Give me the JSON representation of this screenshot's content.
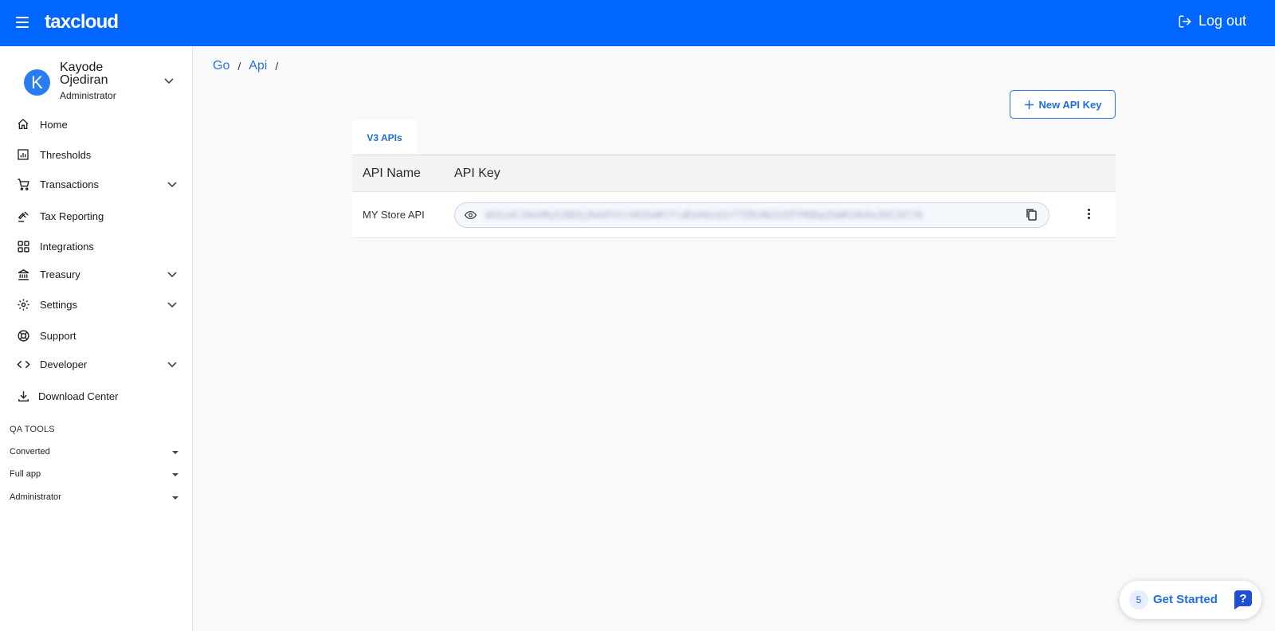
{
  "app": {
    "brand": "taxcloud",
    "logout_label": "Log out"
  },
  "user": {
    "initial": "K",
    "name": "Kayode Ojediran",
    "role": "Administrator"
  },
  "sidebar": {
    "items": [
      {
        "label": "Home"
      },
      {
        "label": "Thresholds"
      },
      {
        "label": "Transactions"
      },
      {
        "label": "Tax Reporting"
      },
      {
        "label": "Integrations"
      },
      {
        "label": "Treasury"
      },
      {
        "label": "Settings"
      },
      {
        "label": "Support"
      },
      {
        "label": "Developer"
      },
      {
        "label": "Download Center"
      }
    ],
    "qa_tools": {
      "title": "QA TOOLS",
      "selects": [
        {
          "value": "Converted"
        },
        {
          "value": "Full app"
        },
        {
          "value": "Administrator"
        }
      ]
    }
  },
  "breadcrumb": {
    "items": [
      "Go",
      "Api"
    ],
    "separator": "/"
  },
  "toolbar": {
    "new_key_label": "New API Key"
  },
  "tabs": [
    {
      "label": "V3 APIs"
    }
  ],
  "table": {
    "headers": [
      "API Name",
      "API Key"
    ],
    "rows": [
      {
        "name": "MY Store API",
        "key": "dGVzdC10eGMyX1BEbjRaVFhYckR3SmRlYldEeHdzd2xTTERzNG1UZFFMODp2bmR2dk0xZHZJOTJ6"
      }
    ]
  },
  "get_started": {
    "count": "5",
    "label": "Get Started"
  },
  "colors": {
    "primary": "#0066ff",
    "accent": "#2a74e0",
    "background": "#f9f9fa"
  }
}
